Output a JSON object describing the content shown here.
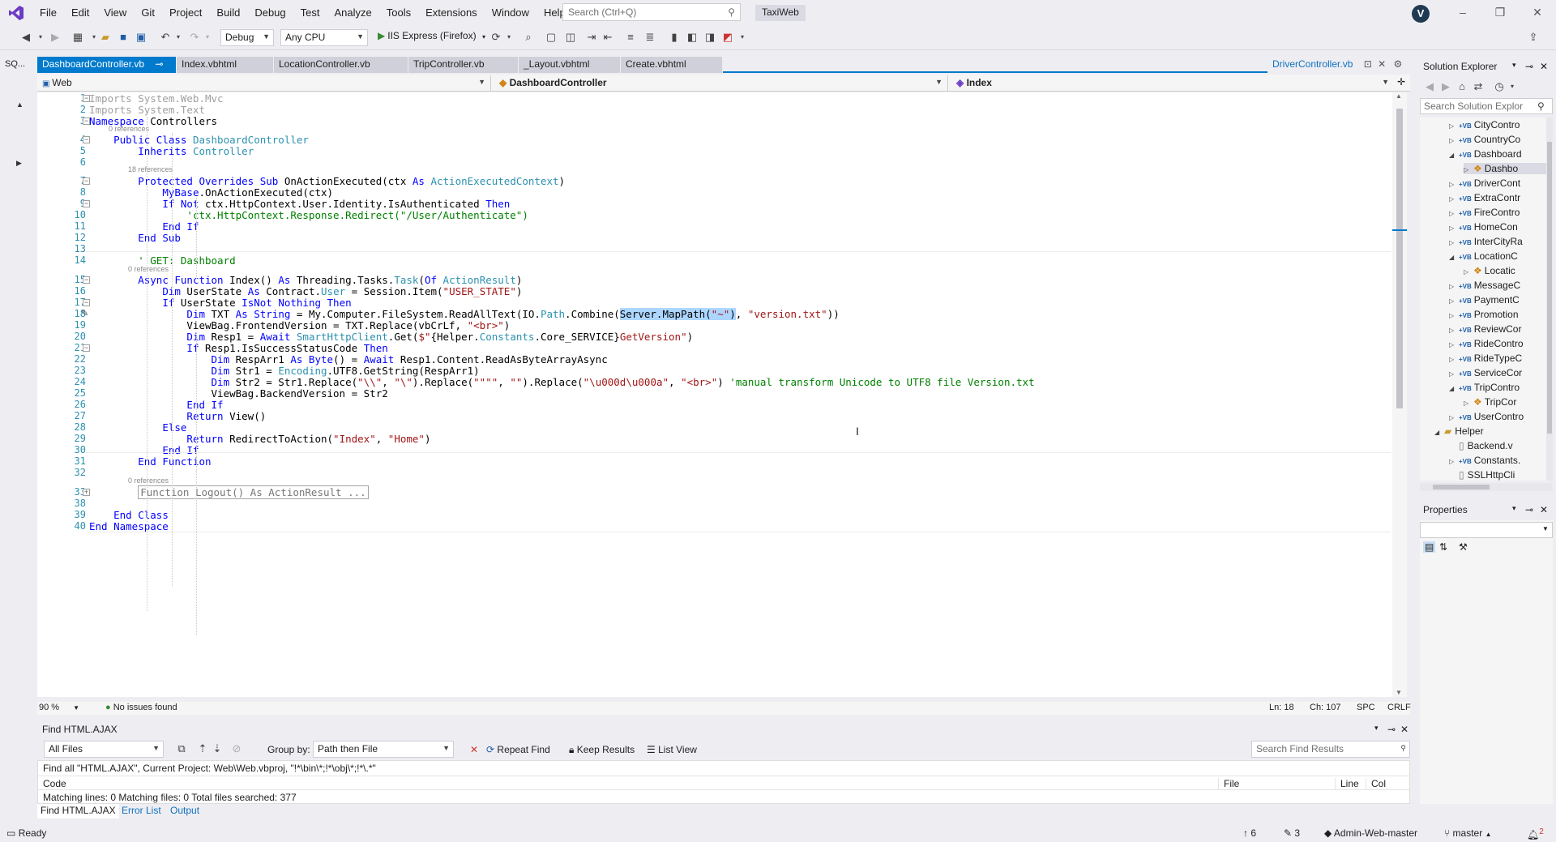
{
  "menu": [
    "File",
    "Edit",
    "View",
    "Git",
    "Project",
    "Build",
    "Debug",
    "Test",
    "Analyze",
    "Tools",
    "Extensions",
    "Window",
    "Help"
  ],
  "search": {
    "placeholder": "Search (Ctrl+Q)"
  },
  "solution_name": "TaxiWeb",
  "user_initial": "V",
  "toolbar": {
    "configuration": "Debug",
    "platform": "Any CPU",
    "run_label": "IIS Express (Firefox)"
  },
  "left_panel_tab": "SQ...",
  "doc_tabs": [
    "DashboardController.vb",
    "Index.vbhtml",
    "LocationController.vb",
    "TripController.vb",
    "_Layout.vbhtml",
    "Create.vbhtml"
  ],
  "preview_tab": "DriverController.vb",
  "navbar": {
    "project": "Web",
    "class": "DashboardController",
    "member": "Index"
  },
  "code_lines": [
    {
      "n": "1",
      "html": "<span class='gray'>Imports System.Web.Mvc</span>"
    },
    {
      "n": "2",
      "html": "<span class='gray'>Imports System.Text</span>"
    },
    {
      "n": "3",
      "html": "<span class='kw'>Namespace</span> Controllers"
    },
    {
      "n": "4",
      "html": "    <span class='kw'>Public Class</span> <span class='ty'>DashboardController</span>"
    },
    {
      "n": "5",
      "html": "        <span class='kw'>Inherits</span> <span class='ty'>Controller</span>"
    },
    {
      "n": "6",
      "html": ""
    },
    {
      "n": "7",
      "html": "        <span class='kw'>Protected Overrides Sub</span> OnActionExecuted(ctx <span class='kw'>As</span> <span class='ty'>ActionExecutedContext</span>)"
    },
    {
      "n": "8",
      "html": "            <span class='kw'>MyBase</span>.OnActionExecuted(ctx)"
    },
    {
      "n": "9",
      "html": "            <span class='kw'>If Not</span> ctx.HttpContext.User.Identity.IsAuthenticated <span class='kw'>Then</span>"
    },
    {
      "n": "10",
      "html": "                <span class='cm'>'ctx.HttpContext.Response.Redirect(\"/User/Authenticate\")</span>"
    },
    {
      "n": "11",
      "html": "            <span class='kw'>End If</span>"
    },
    {
      "n": "12",
      "html": "        <span class='kw'>End Sub</span>"
    },
    {
      "n": "13",
      "html": ""
    },
    {
      "n": "14",
      "html": "        <span class='cm'>' GET: Dashboard</span>"
    },
    {
      "n": "15",
      "html": "        <span class='kw'>Async Function</span> Index() <span class='kw'>As</span> Threading.Tasks.<span class='ty'>Task</span>(<span class='kw'>Of</span> <span class='ty'>ActionResult</span>)"
    },
    {
      "n": "16",
      "html": "            <span class='kw'>Dim</span> UserState <span class='kw'>As</span> Contract.<span class='ty'>User</span> = Session.Item(<span class='str'>\"USER_STATE\"</span>)"
    },
    {
      "n": "17",
      "html": "            <span class='kw'>If</span> UserState <span class='kw'>IsNot Nothing Then</span>"
    },
    {
      "n": "18",
      "html": "                <span class='kw'>Dim</span> TXT <span class='kw'>As String</span> = My.Computer.FileSystem.ReadAllText(IO.<span class='ty'>Path</span>.Combine(<span class='hl'>Server.MapPath(<span class='str'>\"~\"</span>)</span>, <span class='str'>\"version.txt\"</span>))"
    },
    {
      "n": "19",
      "html": "                ViewBag.FrontendVersion = TXT.Replace(vbCrLf, <span class='str'>\"&lt;br&gt;\"</span>)"
    },
    {
      "n": "20",
      "html": "                <span class='kw'>Dim</span> Resp1 = <span class='kw'>Await</span> <span class='ty'>SmartHttpClient</span>.Get(<span class='str'>$\"</span>{Helper.<span class='ty'>Constants</span>.Core_SERVICE}<span class='str'>GetVersion\"</span>)"
    },
    {
      "n": "21",
      "html": "                <span class='kw'>If</span> Resp1.IsSuccessStatusCode <span class='kw'>Then</span>"
    },
    {
      "n": "22",
      "html": "                    <span class='kw'>Dim</span> RespArr1 <span class='kw'>As Byte</span>() = <span class='kw'>Await</span> Resp1.Content.ReadAsByteArrayAsync"
    },
    {
      "n": "23",
      "html": "                    <span class='kw'>Dim</span> Str1 = <span class='ty'>Encoding</span>.UTF8.GetString(RespArr1)"
    },
    {
      "n": "24",
      "html": "                    <span class='kw'>Dim</span> Str2 = Str1.Replace(<span class='str'>\"\\\\\"</span>, <span class='str'>\"\\\"</span>).Replace(<span class='str'>\"\"\"\"</span>, <span class='str'>\"\"</span>).Replace(<span class='str'>\"\\u000d\\u000a\"</span>, <span class='str'>\"&lt;br&gt;\"</span>) <span class='cm'>'manual transform Unicode to UTF8 file Version.txt</span>"
    },
    {
      "n": "25",
      "html": "                    ViewBag.BackendVersion = Str2"
    },
    {
      "n": "26",
      "html": "                <span class='kw'>End If</span>"
    },
    {
      "n": "27",
      "html": "                <span class='kw'>Return</span> View()"
    },
    {
      "n": "28",
      "html": "            <span class='kw'>Else</span>"
    },
    {
      "n": "29",
      "html": "                <span class='kw'>Return</span> RedirectToAction(<span class='str'>\"Index\"</span>, <span class='str'>\"Home\"</span>)"
    },
    {
      "n": "30",
      "html": "            <span class='kw'>End If</span>"
    },
    {
      "n": "31",
      "html": "        <span class='kw'>End Function</span>"
    },
    {
      "n": "32",
      "html": ""
    },
    {
      "n": "33",
      "html": "        <span class='collapsed-box'>Function Logout() As ActionResult ...</span>"
    },
    {
      "n": "38",
      "html": ""
    },
    {
      "n": "39",
      "html": "    <span class='kw'>End Class</span>"
    },
    {
      "n": "40",
      "html": "<span class='kw'>End Namespace</span>"
    }
  ],
  "code_refs": [
    "0 references",
    "18 references",
    "0 references",
    "0 references"
  ],
  "editor_status": {
    "zoom": "90 %",
    "issues": "No issues found",
    "line": "Ln: 18",
    "col": "Ch: 107",
    "spc": "SPC",
    "eol": "CRLF"
  },
  "find_panel": {
    "title": "Find HTML.AJAX",
    "scope": "All Files",
    "group_by_label": "Group by:",
    "group_by_value": "Path then File",
    "repeat_find": "Repeat Find",
    "keep_results": "Keep Results",
    "list_view": "List View",
    "search_placeholder": "Search Find Results",
    "query_text": "Find all \"HTML.AJAX\", Current Project: Web\\Web.vbproj, \"!*\\bin\\*;!*\\obj\\*;!*\\.*\"",
    "col_code": "Code",
    "col_file": "File",
    "col_line": "Line",
    "col_col": "Col",
    "summary": "Matching lines: 0 Matching files: 0 Total files searched: 377",
    "tabs": [
      "Find HTML.AJAX",
      "Error List",
      "Output"
    ]
  },
  "solution_explorer": {
    "title": "Solution Explorer",
    "search_placeholder": "Search Solution Explor",
    "items": [
      {
        "label": "CityContro",
        "type": "vb",
        "indent": 0,
        "state": "collapsed"
      },
      {
        "label": "CountryCo",
        "type": "vb",
        "indent": 0,
        "state": "collapsed"
      },
      {
        "label": "Dashboard",
        "type": "vb",
        "indent": 0,
        "state": "expanded"
      },
      {
        "label": "Dashbo",
        "type": "class",
        "indent": 1,
        "state": "collapsed"
      },
      {
        "label": "DriverCont",
        "type": "vb",
        "indent": 0,
        "state": "collapsed"
      },
      {
        "label": "ExtraContr",
        "type": "vb",
        "indent": 0,
        "state": "collapsed"
      },
      {
        "label": "FireContro",
        "type": "vb",
        "indent": 0,
        "state": "collapsed"
      },
      {
        "label": "HomeCon",
        "type": "vb",
        "indent": 0,
        "state": "collapsed"
      },
      {
        "label": "InterCityRa",
        "type": "vb",
        "indent": 0,
        "state": "collapsed"
      },
      {
        "label": "LocationC",
        "type": "vb",
        "indent": 0,
        "state": "expanded"
      },
      {
        "label": "Locatic",
        "type": "class",
        "indent": 1,
        "state": "collapsed"
      },
      {
        "label": "MessageC",
        "type": "vb",
        "indent": 0,
        "state": "collapsed"
      },
      {
        "label": "PaymentC",
        "type": "vb",
        "indent": 0,
        "state": "collapsed"
      },
      {
        "label": "Promotion",
        "type": "vb",
        "indent": 0,
        "state": "collapsed"
      },
      {
        "label": "ReviewCor",
        "type": "vb",
        "indent": 0,
        "state": "collapsed"
      },
      {
        "label": "RideContro",
        "type": "vb",
        "indent": 0,
        "state": "collapsed"
      },
      {
        "label": "RideTypeC",
        "type": "vb",
        "indent": 0,
        "state": "collapsed"
      },
      {
        "label": "ServiceCor",
        "type": "vb",
        "indent": 0,
        "state": "collapsed"
      },
      {
        "label": "TripContro",
        "type": "vb",
        "indent": 0,
        "state": "expanded"
      },
      {
        "label": "TripCor",
        "type": "class",
        "indent": 1,
        "state": "collapsed"
      },
      {
        "label": "UserContro",
        "type": "vb",
        "indent": 0,
        "state": "collapsed"
      },
      {
        "label": "Helper",
        "type": "folder",
        "indent": -1,
        "state": "expanded"
      },
      {
        "label": "Backend.v",
        "type": "file",
        "indent": 0,
        "state": "none"
      },
      {
        "label": "Constants.",
        "type": "vb",
        "indent": 0,
        "state": "collapsed"
      },
      {
        "label": "SSLHttpCli",
        "type": "file",
        "indent": 0,
        "state": "none"
      }
    ]
  },
  "properties": {
    "title": "Properties"
  },
  "statusbar": {
    "ready": "Ready",
    "up_count": "6",
    "pencil_count": "3",
    "repo": "Admin-Web-master",
    "branch": "master",
    "notifications": "2"
  },
  "colors": {
    "accent": "#007acc",
    "keyword": "#0000ff",
    "type": "#2b91af",
    "string": "#a31515",
    "comment": "#008000",
    "selection": "#add6ff"
  }
}
